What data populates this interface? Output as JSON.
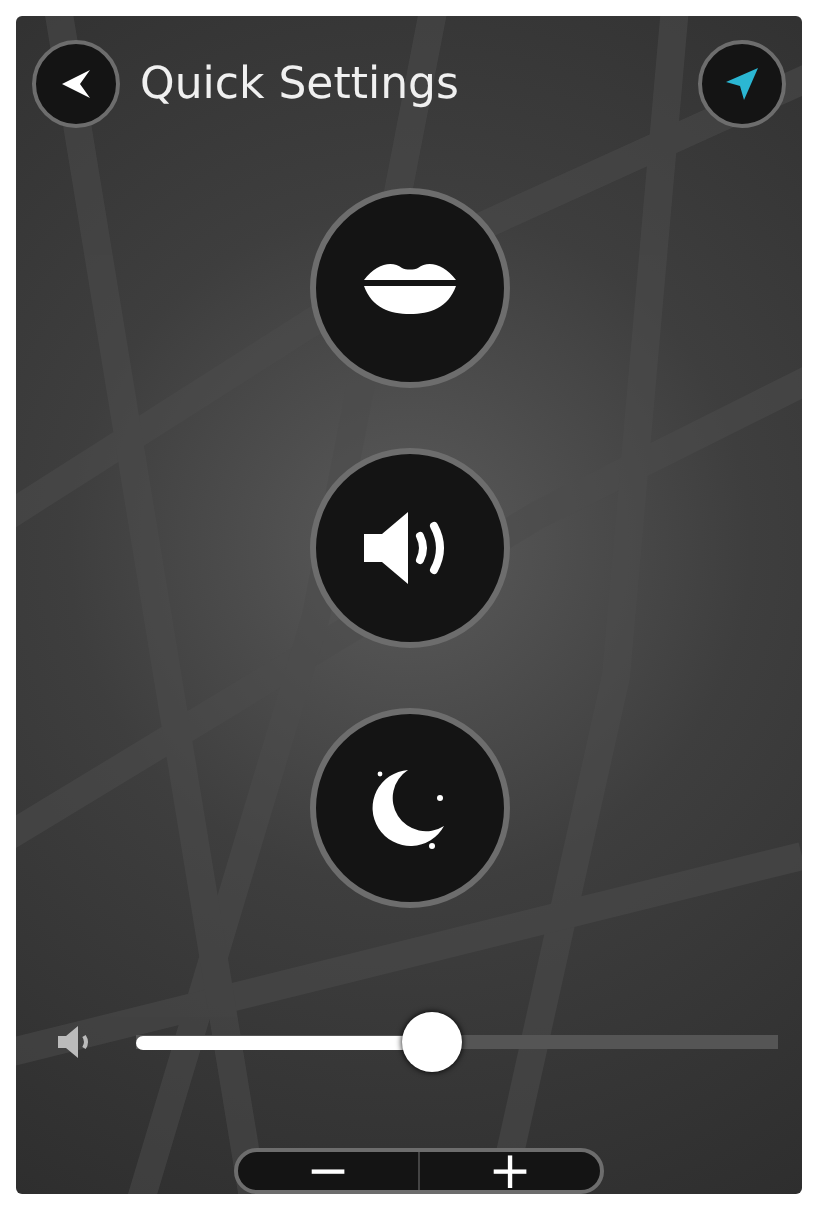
{
  "header": {
    "title": "Quick Settings"
  },
  "toggles": [
    {
      "kind": "voice"
    },
    {
      "kind": "sound"
    },
    {
      "kind": "night"
    }
  ],
  "volume": {
    "level": 0.46
  },
  "zoom": {
    "minus": "−",
    "plus": "+"
  }
}
